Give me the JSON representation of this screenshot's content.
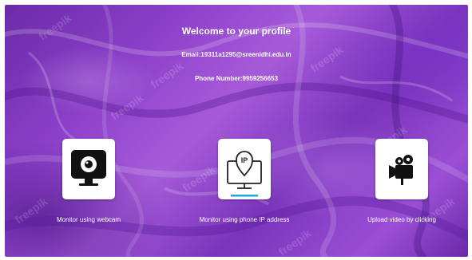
{
  "profile": {
    "welcome": "Welcome to your profile",
    "email": "Email:19311a1295@sreenidhi.edu.in",
    "phone": "Phone Number:9959256653"
  },
  "options": [
    {
      "label": "Monitor using webcam",
      "icon": "webcam-icon"
    },
    {
      "label": "Monitor using phone IP address",
      "icon": "ip-monitor-icon"
    },
    {
      "label": "Upload video by clicking",
      "icon": "video-camera-icon"
    }
  ],
  "watermark": "freepik",
  "colors": {
    "background_primary": "#8c3fc9",
    "background_dark": "#6a2ba8",
    "text": "#ffffff",
    "card": "#ffffff",
    "ip_underline": "#1ea7d8"
  }
}
